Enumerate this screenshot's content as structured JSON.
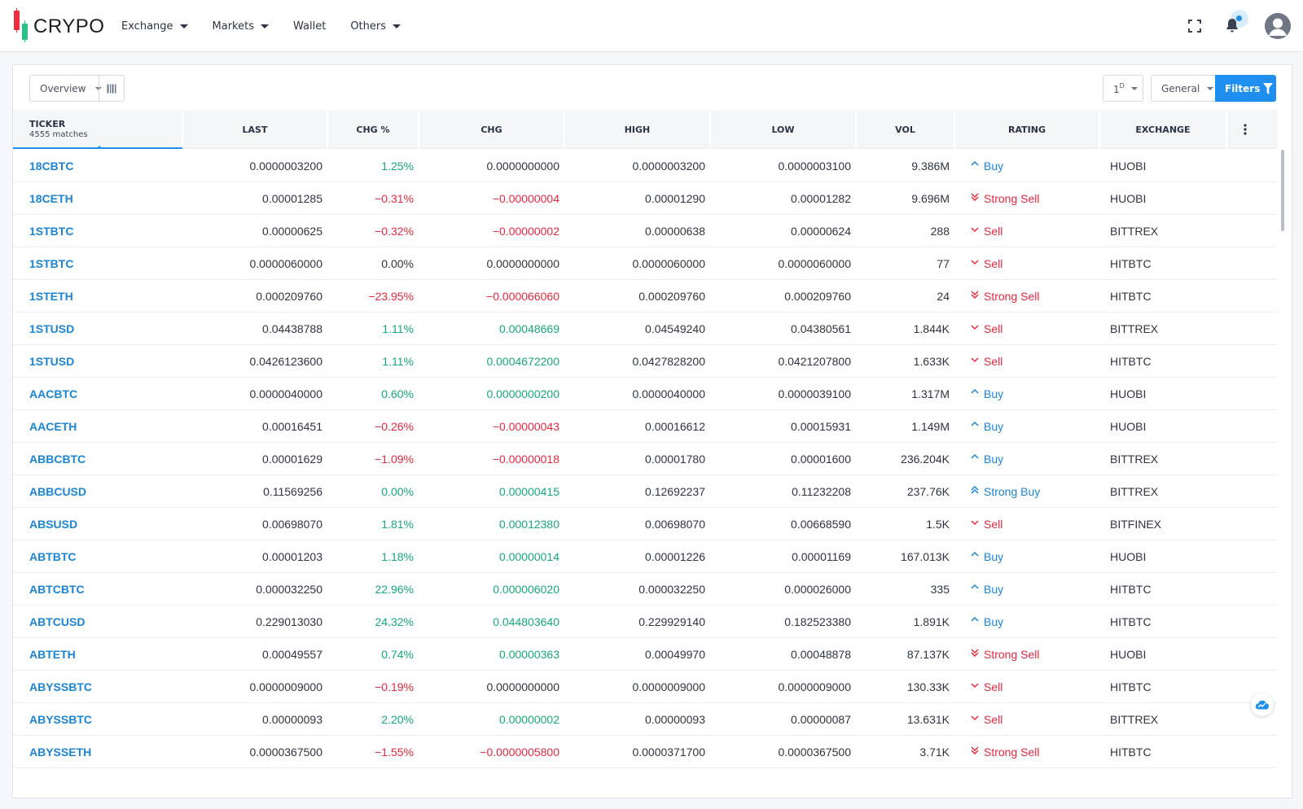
{
  "app": {
    "logo_text": "CRYPO",
    "nav": [
      {
        "label": "Exchange",
        "dropdown": true
      },
      {
        "label": "Markets",
        "dropdown": true
      },
      {
        "label": "Wallet",
        "dropdown": false
      },
      {
        "label": "Others",
        "dropdown": true
      }
    ],
    "icons": [
      "fullscreen-icon",
      "bell-icon",
      "avatar"
    ]
  },
  "toolbar": {
    "overview_label": "Overview",
    "period_label": "1",
    "period_sup": "D",
    "general_label": "General",
    "filters_label": "Filters"
  },
  "colors": {
    "accent": "#1e8ff0",
    "positive": "#15a97a",
    "negative": "#e8283d",
    "link": "#1a84d6"
  },
  "table": {
    "columns": [
      {
        "key": "ticker",
        "label": "TICKER",
        "sub": "4555 matches"
      },
      {
        "key": "last",
        "label": "LAST"
      },
      {
        "key": "chg_pct",
        "label": "CHG %"
      },
      {
        "key": "chg",
        "label": "CHG"
      },
      {
        "key": "high",
        "label": "HIGH"
      },
      {
        "key": "low",
        "label": "LOW"
      },
      {
        "key": "vol",
        "label": "VOL"
      },
      {
        "key": "rating",
        "label": "RATING"
      },
      {
        "key": "exchange",
        "label": "EXCHANGE"
      }
    ],
    "rows": [
      {
        "ticker": "18CBTC",
        "last": "0.0000003200",
        "chg_pct": "1.25%",
        "chg": "0.0000000000",
        "high": "0.0000003200",
        "low": "0.0000003100",
        "vol": "9.386M",
        "rating": "Buy",
        "exchange": "HUOBI",
        "pct_dir": "pos",
        "chg_dir": "neutral"
      },
      {
        "ticker": "18CETH",
        "last": "0.00001285",
        "chg_pct": "−0.31%",
        "chg": "−0.00000004",
        "high": "0.00001290",
        "low": "0.00001282",
        "vol": "9.696M",
        "rating": "Strong Sell",
        "exchange": "HUOBI",
        "pct_dir": "neg",
        "chg_dir": "neg"
      },
      {
        "ticker": "1STBTC",
        "last": "0.00000625",
        "chg_pct": "−0.32%",
        "chg": "−0.00000002",
        "high": "0.00000638",
        "low": "0.00000624",
        "vol": "288",
        "rating": "Sell",
        "exchange": "BITTREX",
        "pct_dir": "neg",
        "chg_dir": "neg"
      },
      {
        "ticker": "1STBTC",
        "last": "0.0000060000",
        "chg_pct": "0.00%",
        "chg": "0.0000000000",
        "high": "0.0000060000",
        "low": "0.0000060000",
        "vol": "77",
        "rating": "Sell",
        "exchange": "HITBTC",
        "pct_dir": "neutral",
        "chg_dir": "neutral"
      },
      {
        "ticker": "1STETH",
        "last": "0.000209760",
        "chg_pct": "−23.95%",
        "chg": "−0.000066060",
        "high": "0.000209760",
        "low": "0.000209760",
        "vol": "24",
        "rating": "Strong Sell",
        "exchange": "HITBTC",
        "pct_dir": "neg",
        "chg_dir": "neg"
      },
      {
        "ticker": "1STUSD",
        "last": "0.04438788",
        "chg_pct": "1.11%",
        "chg": "0.00048669",
        "high": "0.04549240",
        "low": "0.04380561",
        "vol": "1.844K",
        "rating": "Sell",
        "exchange": "BITTREX",
        "pct_dir": "pos",
        "chg_dir": "pos"
      },
      {
        "ticker": "1STUSD",
        "last": "0.0426123600",
        "chg_pct": "1.11%",
        "chg": "0.0004672200",
        "high": "0.0427828200",
        "low": "0.0421207800",
        "vol": "1.633K",
        "rating": "Sell",
        "exchange": "HITBTC",
        "pct_dir": "pos",
        "chg_dir": "pos"
      },
      {
        "ticker": "AACBTC",
        "last": "0.0000040000",
        "chg_pct": "0.60%",
        "chg": "0.0000000200",
        "high": "0.0000040000",
        "low": "0.0000039100",
        "vol": "1.317M",
        "rating": "Buy",
        "exchange": "HUOBI",
        "pct_dir": "pos",
        "chg_dir": "pos"
      },
      {
        "ticker": "AACETH",
        "last": "0.00016451",
        "chg_pct": "−0.26%",
        "chg": "−0.00000043",
        "high": "0.00016612",
        "low": "0.00015931",
        "vol": "1.149M",
        "rating": "Buy",
        "exchange": "HUOBI",
        "pct_dir": "neg",
        "chg_dir": "neg"
      },
      {
        "ticker": "ABBCBTC",
        "last": "0.00001629",
        "chg_pct": "−1.09%",
        "chg": "−0.00000018",
        "high": "0.00001780",
        "low": "0.00001600",
        "vol": "236.204K",
        "rating": "Buy",
        "exchange": "BITTREX",
        "pct_dir": "neg",
        "chg_dir": "neg"
      },
      {
        "ticker": "ABBCUSD",
        "last": "0.11569256",
        "chg_pct": "0.00%",
        "chg": "0.00000415",
        "high": "0.12692237",
        "low": "0.11232208",
        "vol": "237.76K",
        "rating": "Strong Buy",
        "exchange": "BITTREX",
        "pct_dir": "pos",
        "chg_dir": "pos"
      },
      {
        "ticker": "ABSUSD",
        "last": "0.00698070",
        "chg_pct": "1.81%",
        "chg": "0.00012380",
        "high": "0.00698070",
        "low": "0.00668590",
        "vol": "1.5K",
        "rating": "Sell",
        "exchange": "BITFINEX",
        "pct_dir": "pos",
        "chg_dir": "pos"
      },
      {
        "ticker": "ABTBTC",
        "last": "0.00001203",
        "chg_pct": "1.18%",
        "chg": "0.00000014",
        "high": "0.00001226",
        "low": "0.00001169",
        "vol": "167.013K",
        "rating": "Buy",
        "exchange": "HUOBI",
        "pct_dir": "pos",
        "chg_dir": "pos"
      },
      {
        "ticker": "ABTCBTC",
        "last": "0.000032250",
        "chg_pct": "22.96%",
        "chg": "0.000006020",
        "high": "0.000032250",
        "low": "0.000026000",
        "vol": "335",
        "rating": "Buy",
        "exchange": "HITBTC",
        "pct_dir": "pos",
        "chg_dir": "pos"
      },
      {
        "ticker": "ABTCUSD",
        "last": "0.229013030",
        "chg_pct": "24.32%",
        "chg": "0.044803640",
        "high": "0.229929140",
        "low": "0.182523380",
        "vol": "1.891K",
        "rating": "Buy",
        "exchange": "HITBTC",
        "pct_dir": "pos",
        "chg_dir": "pos"
      },
      {
        "ticker": "ABTETH",
        "last": "0.00049557",
        "chg_pct": "0.74%",
        "chg": "0.00000363",
        "high": "0.00049970",
        "low": "0.00048878",
        "vol": "87.137K",
        "rating": "Strong Sell",
        "exchange": "HUOBI",
        "pct_dir": "pos",
        "chg_dir": "pos"
      },
      {
        "ticker": "ABYSSBTC",
        "last": "0.0000009000",
        "chg_pct": "−0.19%",
        "chg": "0.0000000000",
        "high": "0.0000009000",
        "low": "0.0000009000",
        "vol": "130.33K",
        "rating": "Sell",
        "exchange": "HITBTC",
        "pct_dir": "neg",
        "chg_dir": "neutral"
      },
      {
        "ticker": "ABYSSBTC",
        "last": "0.00000093",
        "chg_pct": "2.20%",
        "chg": "0.00000002",
        "high": "0.00000093",
        "low": "0.00000087",
        "vol": "13.631K",
        "rating": "Sell",
        "exchange": "BITTREX",
        "pct_dir": "pos",
        "chg_dir": "pos"
      },
      {
        "ticker": "ABYSSETH",
        "last": "0.0000367500",
        "chg_pct": "−1.55%",
        "chg": "−0.0000005800",
        "high": "0.0000371700",
        "low": "0.0000367500",
        "vol": "3.71K",
        "rating": "Strong Sell",
        "exchange": "HITBTC",
        "pct_dir": "neg",
        "chg_dir": "neg"
      }
    ]
  }
}
